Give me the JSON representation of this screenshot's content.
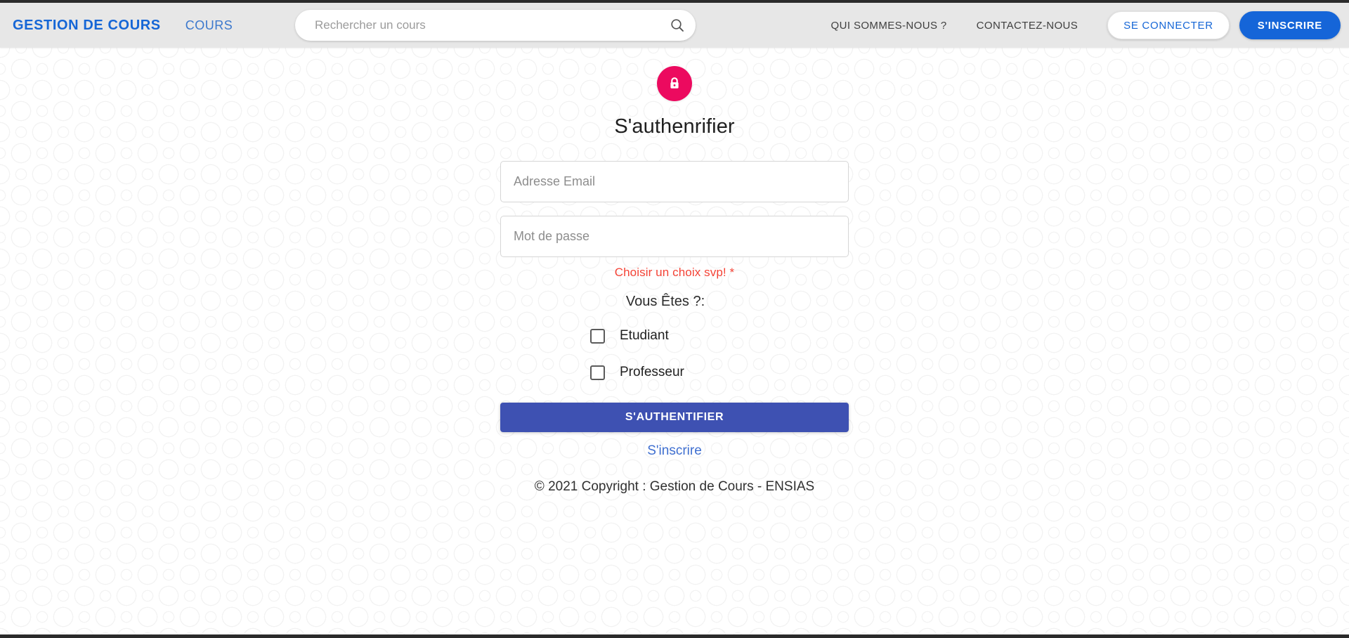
{
  "header": {
    "brand": "GESTION DE COURS",
    "nav_cours": "COURS",
    "search": {
      "placeholder": "Rechercher un cours",
      "value": "",
      "icon": "search-icon"
    },
    "links": [
      {
        "label": "QUI SOMMES-NOUS ?"
      },
      {
        "label": "CONTACTEZ-NOUS"
      }
    ],
    "login_button": "SE CONNECTER",
    "signup_button": "S'INSCRIRE",
    "colors": {
      "brand_blue": "#1566d6",
      "signup_bg": "#1565d8",
      "bar_bg": "#e7e7e7"
    }
  },
  "auth": {
    "lock_icon": "lock-icon",
    "lock_color": "#ec0a5f",
    "title": "S'authenrifier",
    "email": {
      "placeholder": "Adresse Email",
      "value": ""
    },
    "password": {
      "placeholder": "Mot de passe",
      "value": ""
    },
    "error_message": "Choisir un choix svp! *",
    "error_color": "#f44336",
    "question": "Vous Êtes ?:",
    "choices": [
      {
        "label": "Etudiant",
        "checked": false
      },
      {
        "label": "Professeur",
        "checked": false
      }
    ],
    "submit_button": "S'AUTHENTIFIER",
    "submit_color": "#3e51b2",
    "signup_link": "S'inscrire"
  },
  "footer": {
    "copyright": "© 2021 Copyright : Gestion de Cours - ENSIAS"
  }
}
